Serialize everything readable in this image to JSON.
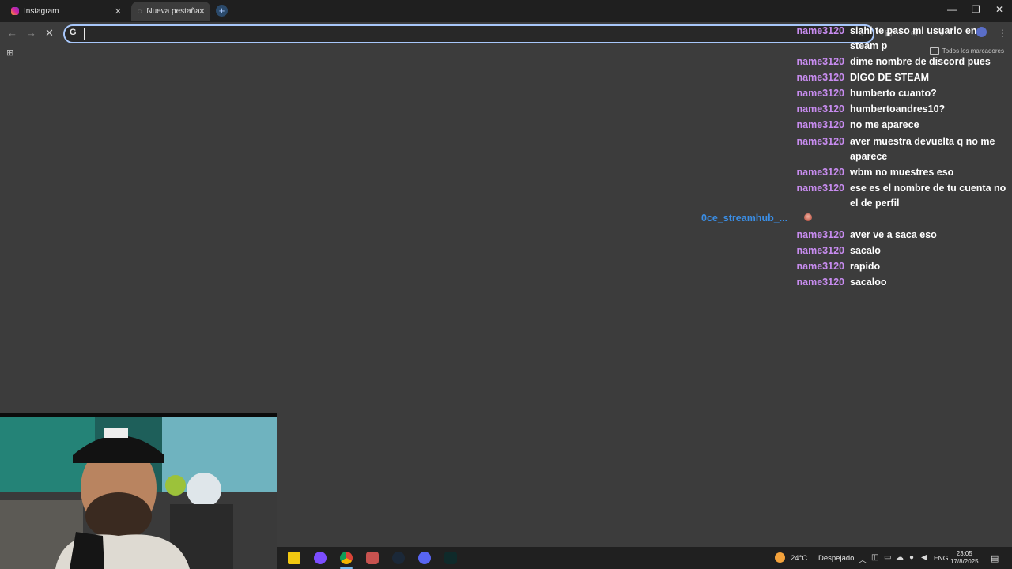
{
  "browser": {
    "tabs": [
      {
        "title": "Instagram",
        "active": false
      },
      {
        "title": "Nueva pestaña",
        "active": true
      }
    ],
    "omnibox": {
      "value": "",
      "placeholder": ""
    },
    "bookmarks_bar": {
      "all_bookmarks_label": "Todos los marcadores"
    },
    "accent_color": "#a8c7fa"
  },
  "chat": {
    "username_color": "#c88cf0",
    "alt_username_color": "#3a8ee6",
    "messages": [
      {
        "user": "name3120",
        "text": "siahi te paso mi usuario en steam p"
      },
      {
        "user": "name3120",
        "text": "dime nombre de discord pues"
      },
      {
        "user": "name3120",
        "text": "DIGO DE STEAM"
      },
      {
        "user": "name3120",
        "text": "humberto cuanto?"
      },
      {
        "user": "name3120",
        "text": "humbertoandres10?"
      },
      {
        "user": "name3120",
        "text": "no me aparece"
      },
      {
        "user": "name3120",
        "text": "aver muestra devuelta q no me aparece"
      },
      {
        "user": "name3120",
        "text": "wbm no muestres eso"
      },
      {
        "user": "name3120",
        "text": "ese es el nombre de tu cuenta no el de perfil"
      },
      {
        "user": "0ce_streamhub_...",
        "text": "",
        "emote": "emote-icon"
      },
      {
        "user": "name3120",
        "text": "aver ve a saca eso"
      },
      {
        "user": "name3120",
        "text": "sacalo"
      },
      {
        "user": "name3120",
        "text": "rapido"
      },
      {
        "user": "name3120",
        "text": "sacaloo"
      }
    ]
  },
  "taskbar": {
    "weather_temp": "24°C",
    "weather_desc": "Despejado",
    "language": "ENG",
    "time": "23:05",
    "date": "17/8/2025"
  }
}
